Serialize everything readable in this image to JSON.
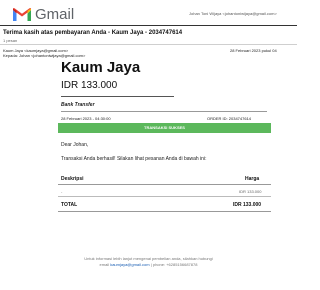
{
  "header": {
    "app_name": "Gmail",
    "user": "Johan Toni Wijaya <johantoniwijaya@gmail.com>"
  },
  "thread": {
    "subject": "Terima kasih atas pembayaran Anda - Kaum Jaya - 2034747614",
    "message_count": "1 pesan"
  },
  "email": {
    "from": "Kaum Jaya <kaumjaya@gmail.com>",
    "to": "Kepada: Johan <johantoniwijaya@gmail.com>",
    "date": "28 Februari 2023 pukul 04"
  },
  "receipt": {
    "store_name": "Kaum Jaya",
    "amount": "IDR 133.000",
    "method": "Bank Transfer",
    "tx_date": "28 Februari 2023 - 04:30:00",
    "order_id": "ORDER ID: 2034747614",
    "status": "TRANSAKSI SUKSES",
    "greeting": "Dear Johan,",
    "message": "Transaksi Anda berhasil! Silakan lihat pesanan Anda di bawah ini:",
    "table": {
      "col_desc": "Deskripsi",
      "col_price": "Harga",
      "item_desc": "-",
      "item_price": "IDR 133.000",
      "total_label": "TOTAL",
      "total_value": "IDR 133.000"
    }
  },
  "footer": {
    "line1": "Untuk informasi lebih lanjut mengenai pembelian anda, silahkan hubungi",
    "line2_prefix": "email ",
    "line2_email": "kaumjaya@gmail.com",
    "line2_suffix": " | phone: +6285156687878"
  },
  "colors": {
    "status_bar": "#5cb85c",
    "gmail_red": "#ea4335",
    "gmail_blue": "#4285f4",
    "gmail_green": "#34a853",
    "gmail_yellow": "#fbbc04"
  }
}
